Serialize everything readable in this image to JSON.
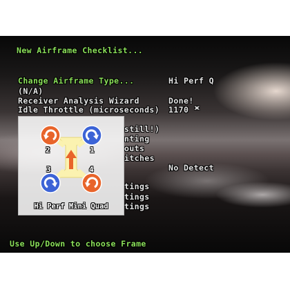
{
  "screen": {
    "title": "New Airframe Checklist...",
    "footer_hint": "Use Up/Down to choose Frame"
  },
  "menu": {
    "items": [
      {
        "label": "Change Airframe Type...",
        "value": "Hi Perf Q"
      },
      {
        "label": "(N/A)",
        "value": ""
      },
      {
        "label": "Receiver Analysis Wizard",
        "value": "Done!"
      },
      {
        "label": "Idle Throttle (microseconds)",
        "value": "1170"
      }
    ],
    "partial_rows": [
      {
        "text": "still!)"
      },
      {
        "text": "nting"
      },
      {
        "text": "outs"
      },
      {
        "text": "itches"
      },
      {
        "text": "No Detect"
      },
      {
        "text": "tings"
      },
      {
        "text": "tings"
      },
      {
        "text": "tings"
      }
    ]
  },
  "frame_preview": {
    "name": "Hi Perf Mini Quad",
    "motors": [
      {
        "number": "2",
        "spin": "orange",
        "position": "front-left"
      },
      {
        "number": "1",
        "spin": "blue",
        "position": "front-right"
      },
      {
        "number": "3",
        "spin": "blue",
        "position": "rear-left"
      },
      {
        "number": "4",
        "spin": "orange",
        "position": "rear-right"
      }
    ],
    "direction": "forward-arrow",
    "colors": {
      "orange_prop": "#e8642a",
      "blue_prop": "#3c63d6",
      "body": "#fbf2b0",
      "arrow": "#e8642a"
    }
  }
}
